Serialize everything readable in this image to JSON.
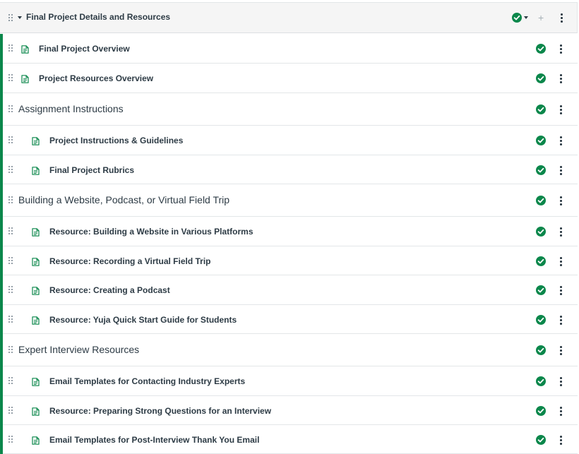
{
  "module": {
    "title": "Final Project Details and Resources",
    "published": true,
    "add_label": "+"
  },
  "items": [
    {
      "type": "page",
      "indent": 1,
      "title": "Final Project Overview",
      "published": true
    },
    {
      "type": "page",
      "indent": 1,
      "title": "Project Resources Overview",
      "published": true
    },
    {
      "type": "subheader",
      "indent": 0,
      "title": "Assignment Instructions",
      "published": true
    },
    {
      "type": "page",
      "indent": 2,
      "title": "Project Instructions & Guidelines",
      "published": true
    },
    {
      "type": "page",
      "indent": 2,
      "title": "Final Project Rubrics",
      "published": true
    },
    {
      "type": "subheader",
      "indent": 0,
      "title": "Building a Website, Podcast, or Virtual Field Trip",
      "published": true
    },
    {
      "type": "page",
      "indent": 2,
      "title": "Resource: Building a Website in Various Platforms",
      "published": true
    },
    {
      "type": "page",
      "indent": 2,
      "title": "Resource: Recording a Virtual Field Trip",
      "published": true
    },
    {
      "type": "page",
      "indent": 2,
      "title": "Resource: Creating a Podcast",
      "published": true
    },
    {
      "type": "page",
      "indent": 2,
      "title": "Resource: Yuja Quick Start Guide for Students",
      "published": true
    },
    {
      "type": "subheader",
      "indent": 0,
      "title": "Expert Interview Resources",
      "published": true
    },
    {
      "type": "page",
      "indent": 2,
      "title": "Email Templates for Contacting Industry Experts",
      "published": true
    },
    {
      "type": "page",
      "indent": 2,
      "title": "Resource: Preparing Strong Questions for an Interview",
      "published": true
    },
    {
      "type": "page",
      "indent": 2,
      "title": "Email Templates for Post-Interview Thank You Email",
      "published": true
    }
  ],
  "icons": {
    "drag": "drag-handle-icon",
    "page": "document-icon",
    "published": "published-check-icon",
    "menu": "kebab-menu-icon",
    "expand": "caret-down-icon",
    "add": "plus-icon"
  },
  "colors": {
    "accent_green": "#0b874b",
    "text": "#2d3b45",
    "header_bg": "#f5f5f5",
    "border": "#e3e6e8"
  }
}
